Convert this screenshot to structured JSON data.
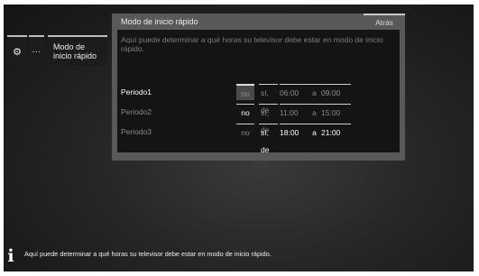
{
  "menu": {
    "gear_icon": "gear-icon",
    "dots_label": "···",
    "item_label_line1": "Modo de",
    "item_label_line2": "inicio rápido"
  },
  "dialog": {
    "title": "Modo de inicio rápido",
    "back_label": "Atrás",
    "description": "Aquí puede determinar a qué horas su televisor debe estar en modo de inicio rápido.",
    "periods": [
      {
        "name": "Periodo1",
        "no": "no",
        "si": "sí, de",
        "start": "06:00",
        "a": "a",
        "end": "09:00"
      },
      {
        "name": "Periodo2",
        "no": "no",
        "si": "sí, de",
        "start": "11:00",
        "a": "a",
        "end": "15:00"
      },
      {
        "name": "Periodo3",
        "no": "no",
        "si": "sí, de",
        "start": "18:00",
        "a": "a",
        "end": "21:00"
      }
    ]
  },
  "info": {
    "icon": "info-icon",
    "text": "Aquí puede determinar a qué horas su televisor debe estar en modo de inicio rápido."
  }
}
